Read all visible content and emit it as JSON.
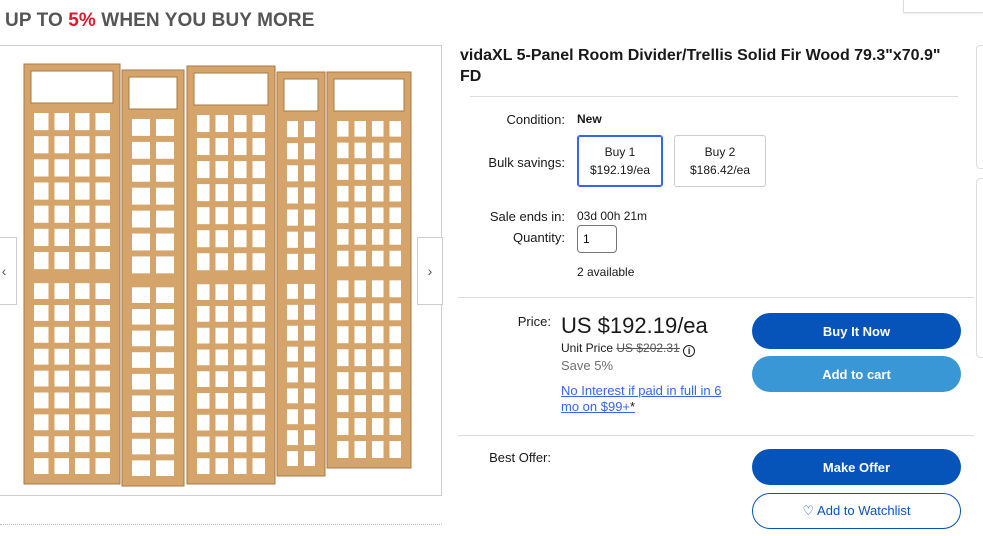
{
  "banner": {
    "prefix": "UP TO ",
    "percent": "5%",
    "suffix": " WHEN YOU BUY MORE"
  },
  "product": {
    "title": "vidaXL 5-Panel Room Divider/Trellis Solid Fir Wood 79.3\"x70.9\" FD"
  },
  "gallery": {
    "prev_icon": "‹",
    "next_icon": "›"
  },
  "condition": {
    "label": "Condition:",
    "value": "New"
  },
  "bulk": {
    "label": "Bulk savings:",
    "options": [
      {
        "qty": "Buy 1",
        "price": "$192.19/ea",
        "selected": true
      },
      {
        "qty": "Buy 2",
        "price": "$186.42/ea",
        "selected": false
      }
    ]
  },
  "sale": {
    "label": "Sale ends in:",
    "value": "03d 00h 21m"
  },
  "quantity": {
    "label": "Quantity:",
    "value": "1",
    "available": "2 available"
  },
  "price": {
    "label": "Price:",
    "value": "US $192.19/ea",
    "unit_label": "Unit Price",
    "original": "US $202.31",
    "info_icon": "i",
    "save": "Save 5%",
    "financing": "No Interest if paid in full in 6 mo on $99+",
    "financing_mark": "*"
  },
  "actions": {
    "buy_now": "Buy It Now",
    "add_to_cart": "Add to cart",
    "best_offer_label": "Best Offer:",
    "make_offer": "Make Offer",
    "watchlist": "♡ Add to Watchlist"
  },
  "colors": {
    "accent": "#0654ba",
    "cart": "#3a97d6",
    "sale_red": "#e0182d",
    "wood": "#d4a46a"
  }
}
